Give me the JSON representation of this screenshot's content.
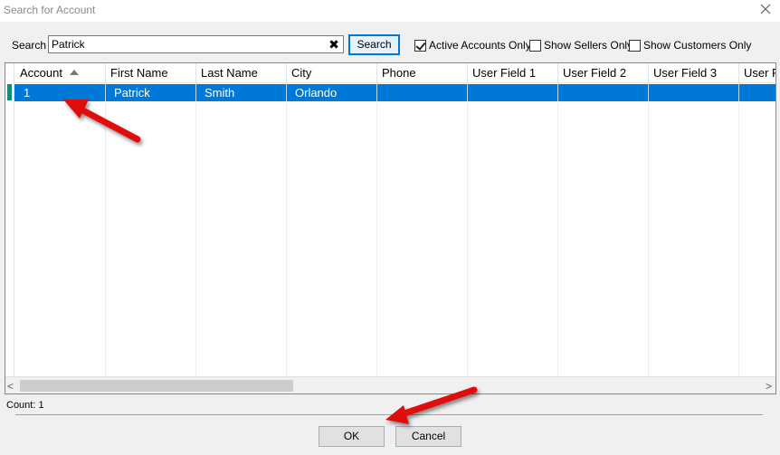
{
  "window": {
    "title": "Search for Account",
    "close_glyph": "✕"
  },
  "search": {
    "label": "Search",
    "value": "Patrick",
    "clear_glyph": "✖",
    "button_label": "Search"
  },
  "filters": [
    {
      "label": "Active Accounts Only",
      "checked": true
    },
    {
      "label": "Show Sellers Only",
      "checked": false
    },
    {
      "label": "Show Customers Only",
      "checked": false
    }
  ],
  "grid": {
    "columns": [
      "Account",
      "First Name",
      "Last Name",
      "City",
      "Phone",
      "User Field 1",
      "User Field 2",
      "User Field 3",
      "User F"
    ],
    "sorted_column": "Account",
    "rows": [
      [
        "1",
        "Patrick",
        "Smith",
        "Orlando",
        "",
        "",
        "",
        "",
        ""
      ]
    ],
    "selected_row": 0,
    "selection_color": "#0078d7"
  },
  "scroll": {
    "left_glyph": "<",
    "right_glyph": ">"
  },
  "status": {
    "count_text": "Count: 1"
  },
  "buttons": {
    "ok": "OK",
    "cancel": "Cancel"
  },
  "annotation_color": "#e01010"
}
